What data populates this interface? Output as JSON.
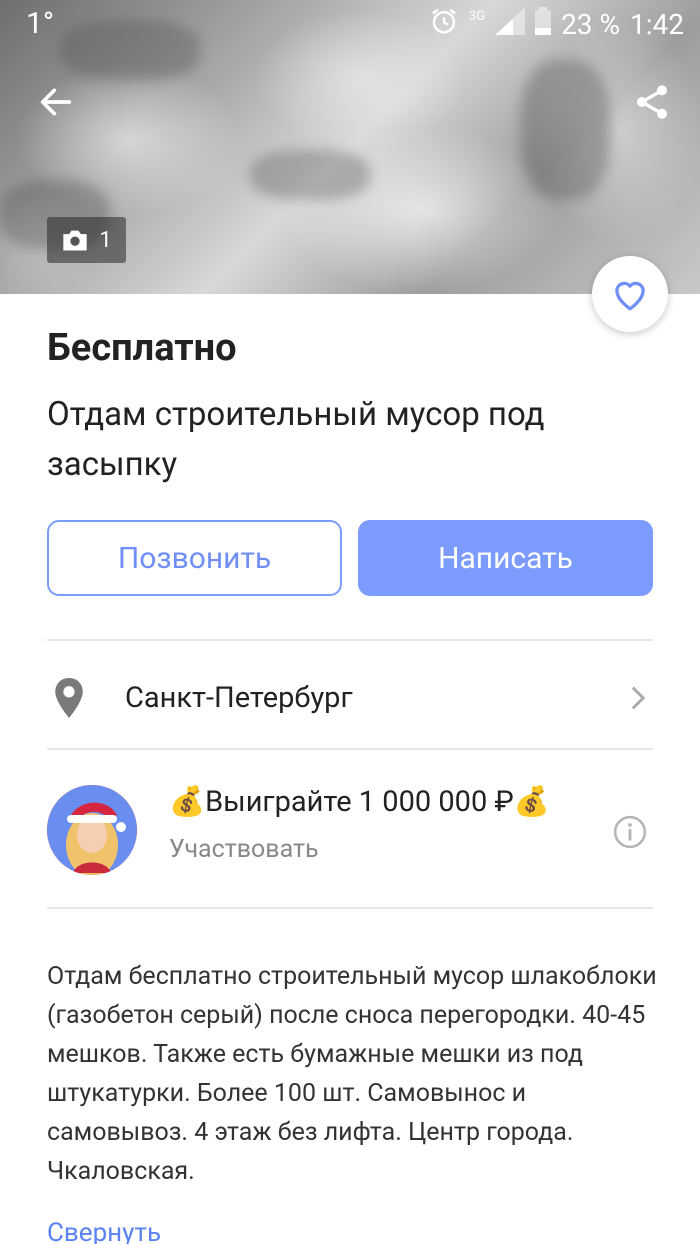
{
  "status_bar": {
    "temperature": "1°",
    "network": "3G",
    "battery": "23 %",
    "time": "1:42"
  },
  "header": {
    "photo_count": "1"
  },
  "listing": {
    "price": "Бесплатно",
    "title": "Отдам строительный мусор под засыпку"
  },
  "actions": {
    "call_label": "Позвонить",
    "write_label": "Написать"
  },
  "location": {
    "city": "Санкт-Петербург"
  },
  "promo": {
    "headline": "💰Выиграйте 1 000 000 ₽💰",
    "subtext": "Участвовать"
  },
  "description": {
    "text": "Отдам бесплатно строительный мусор шлакоблоки (газобетон серый) после сноса перегородки. 40-45 мешков. Также есть бумажные мешки из под штукатурки. Более 100 шт. Самовынос и самовывоз. 4 этаж без лифта. Центр города. Чкаловская.",
    "collapse_label": "Свернуть"
  },
  "colors": {
    "accent": "#7b9bff",
    "link": "#5a82f2",
    "muted_text": "#888888"
  }
}
